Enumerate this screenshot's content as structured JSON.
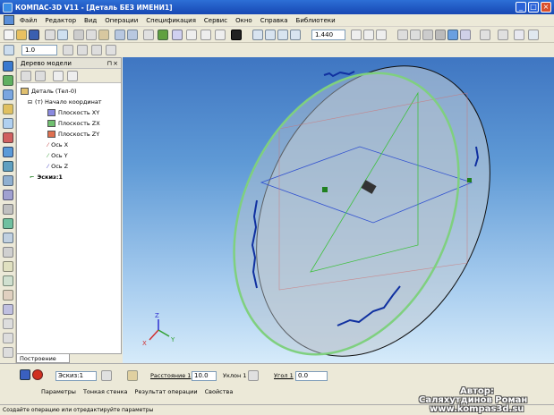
{
  "window": {
    "title": "КОМПАС-3D V11 - [Деталь БЕЗ ИМЕНИ1]"
  },
  "menu": {
    "items": [
      "Файл",
      "Редактор",
      "Вид",
      "Операции",
      "Спецификация",
      "Сервис",
      "Окно",
      "Справка",
      "Библиотеки"
    ]
  },
  "toolbar": {
    "zoom_value": "1.440",
    "scale_value": "1.0"
  },
  "tree": {
    "header": "Дерево модели",
    "root_label": "Деталь (Тел-0)",
    "origin_label": "(т) Начало координат",
    "planes": [
      "Плоскость XY",
      "Плоскость ZX",
      "Плоскость ZY"
    ],
    "axes": [
      "Ось X",
      "Ось Y",
      "Ось Z"
    ],
    "sketch_label": "Эскиз:1",
    "tab_label": "Построение"
  },
  "properties": {
    "sketch_field": "Эскиз:1",
    "distance_label": "Расстояние 1",
    "distance_value": "10.0",
    "angle1_label": "Уклон 1",
    "angle_label": "Угол 1",
    "angle_value": "0.0",
    "tabs": [
      "Параметры",
      "Тонкая стенка",
      "Результат операции",
      "Свойства"
    ]
  },
  "status": {
    "text": "Создайте операцию или отредактируйте параметры"
  },
  "axis_labels": {
    "x": "X",
    "y": "Y",
    "z": "Z"
  },
  "watermark": {
    "line1": "Автор:",
    "line2": "Саляхутдинов Роман",
    "line3": "www.kompas3d.su"
  },
  "colors": {
    "accent_green": "#7fd07f",
    "sketch_blue": "#1030a0",
    "titlebar": "#1f56c8"
  }
}
